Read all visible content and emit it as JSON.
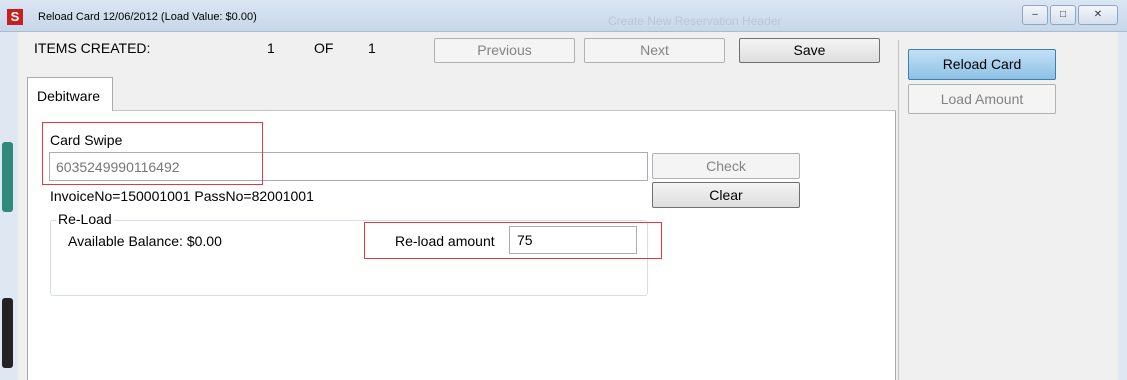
{
  "window": {
    "title": "Reload Card  12/06/2012  (Load Value:  $0.00)",
    "background_title": "Create New Reservation Header",
    "minimize": "‒",
    "maximize": "□",
    "close": "✕"
  },
  "header": {
    "items_created_label": "ITEMS CREATED:",
    "current": "1",
    "of_label": "OF",
    "total": "1",
    "previous_label": "Previous",
    "next_label": "Next",
    "save_label": "Save"
  },
  "tabs": [
    {
      "label": "Debitware",
      "selected": true
    }
  ],
  "card_swipe": {
    "label": "Card Swipe",
    "value": "6035249990116492",
    "check_label": "Check",
    "clear_label": "Clear",
    "info_text": "InvoiceNo=150001001  PassNo=82001001"
  },
  "reload": {
    "group_title": "Re-Load",
    "available_balance": "Available Balance: $0.00",
    "amount_label": "Re-load amount",
    "amount_value": "75"
  },
  "right_panel": {
    "reload_card_label": "Reload Card",
    "load_amount_label": "Load Amount"
  },
  "colors": {
    "highlight_box": "#e53a3a",
    "primary_button": "#8dc1e6",
    "app_icon": "#c62020"
  }
}
